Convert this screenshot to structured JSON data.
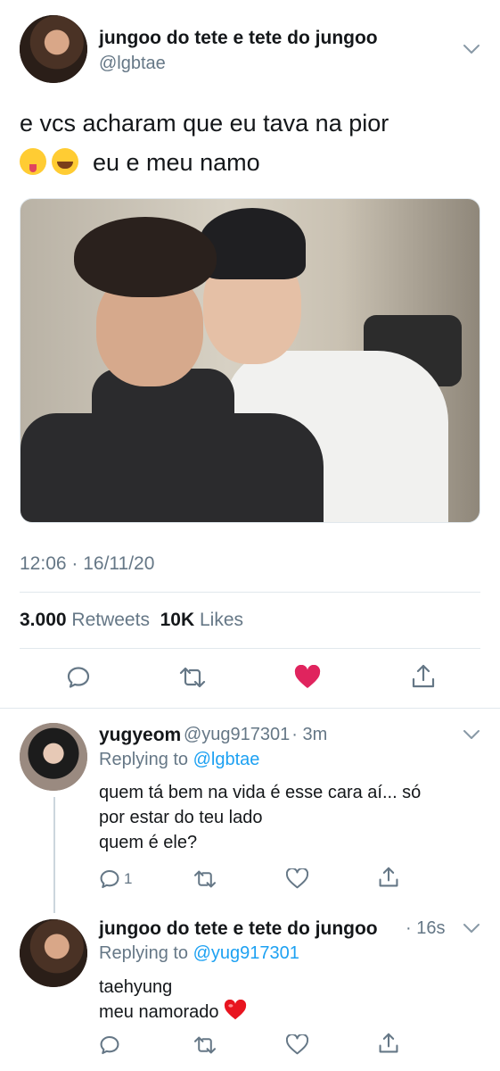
{
  "main_tweet": {
    "author_name": "jungoo do tete e tete do jungoo",
    "handle": "@lgbtae",
    "text_line1": "e vcs acharam que eu tava na pior",
    "text_line2": "eu e meu namo",
    "emoji_1": "squinting-face-with-tongue",
    "emoji_2": "rolling-on-the-floor-laughing",
    "timestamp": "12:06 · 16/11/20",
    "retweets_count": "3.000",
    "retweets_label": "Retweets",
    "likes_count": "10K",
    "likes_label": "Likes",
    "liked": true
  },
  "replies": [
    {
      "author_name": "yugyeom",
      "handle": "@yug917301",
      "time": "· 3m",
      "replying_prefix": "Replying to",
      "replying_to": "@lgbtae",
      "text_lines": [
        "quem tá bem na vida é esse cara aí... só",
        "por estar do teu lado",
        "quem é ele?"
      ],
      "reply_count": "1"
    },
    {
      "author_name": "jungoo do tete e tete do jungoo",
      "time": "· 16s",
      "replying_prefix": "Replying to",
      "replying_to": "@yug917301",
      "text_lines": [
        "taehyung",
        "meu namorado"
      ],
      "emoji": "red-heart"
    }
  ],
  "colors": {
    "text": "#14171a",
    "secondary": "#657786",
    "link": "#1da1f2",
    "like": "#e0245e",
    "divider": "#e1e8ed"
  }
}
